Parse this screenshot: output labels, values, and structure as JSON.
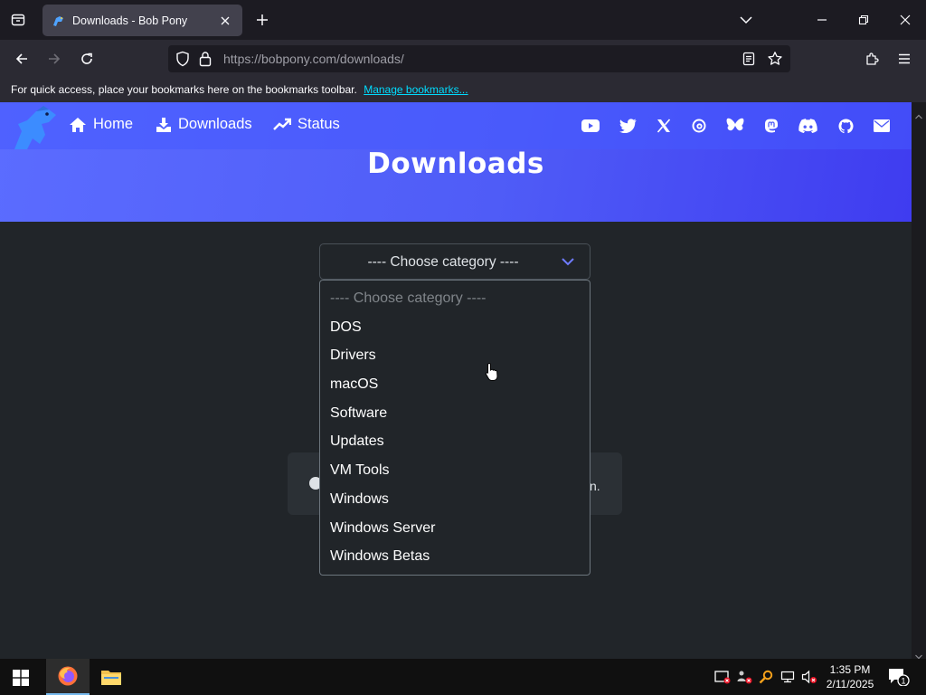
{
  "browser": {
    "tab_title": "Downloads - Bob Pony",
    "url_host": "https://bobpony.com",
    "url_path": "/downloads/",
    "bookmarks_text": "For quick access, place your bookmarks here on the bookmarks toolbar.",
    "bookmarks_link": "Manage bookmarks..."
  },
  "site": {
    "nav": [
      {
        "label": "Home",
        "icon": "home-icon"
      },
      {
        "label": "Downloads",
        "icon": "download-icon"
      },
      {
        "label": "Status",
        "icon": "trending-up-icon"
      }
    ],
    "social_icons": [
      "youtube-icon",
      "twitter-icon",
      "x-icon",
      "threads-icon",
      "bluesky-icon",
      "mastodon-icon",
      "discord-icon",
      "github-icon",
      "mail-icon"
    ],
    "hero_title": "Downloads",
    "accent": "#4f5cf7"
  },
  "category_select": {
    "selected": "---- Choose category ----",
    "options": [
      "---- Choose category ----",
      "DOS",
      "Drivers",
      "macOS",
      "Software",
      "Updates",
      "VM Tools",
      "Windows",
      "Windows Server",
      "Windows Betas"
    ]
  },
  "info_card": {
    "text_fragment": "n."
  },
  "taskbar": {
    "time": "1:35 PM",
    "date": "2/11/2025",
    "notification_count": "1"
  }
}
